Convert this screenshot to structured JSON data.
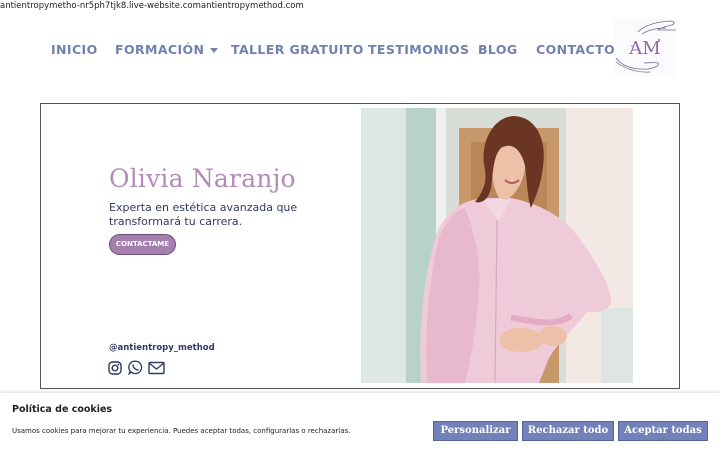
{
  "browser": {
    "url": "antientropymetho-nr5ph7tjk8.live-website.comantientropymethod.com"
  },
  "nav": {
    "items": [
      {
        "label": "INICIO"
      },
      {
        "label": "FORMACIÓN",
        "has_dropdown": true
      },
      {
        "label": "TALLER GRATUITO"
      },
      {
        "label": "TESTIMONIOS"
      },
      {
        "label": "BLOG"
      },
      {
        "label": "CONTACTO"
      }
    ],
    "logo_text": "AM"
  },
  "hero": {
    "name": "Olivia Naranjo",
    "subtitle": "Experta en estética avanzada que transformará tu carrera.",
    "cta_label": "CONTACTAME",
    "handle": "@antientropy_method",
    "social_icons": [
      "instagram-icon",
      "whatsapp-icon",
      "email-icon"
    ]
  },
  "cookie_banner": {
    "title": "Política de cookies",
    "text": "Usamos cookies para mejorar tu experiencia. Puedes aceptar todas, configurarlas o rechazarlas.",
    "buttons": {
      "customize": "Personalizar",
      "reject": "Rechazar todo",
      "accept": "Aceptar todas"
    }
  },
  "colors": {
    "nav_text": "#6f82ad",
    "name_accent": "#b48ab9",
    "cta_bg": "#a57fae",
    "dark_text": "#2f3a66",
    "cookie_button": "#7282b9"
  }
}
